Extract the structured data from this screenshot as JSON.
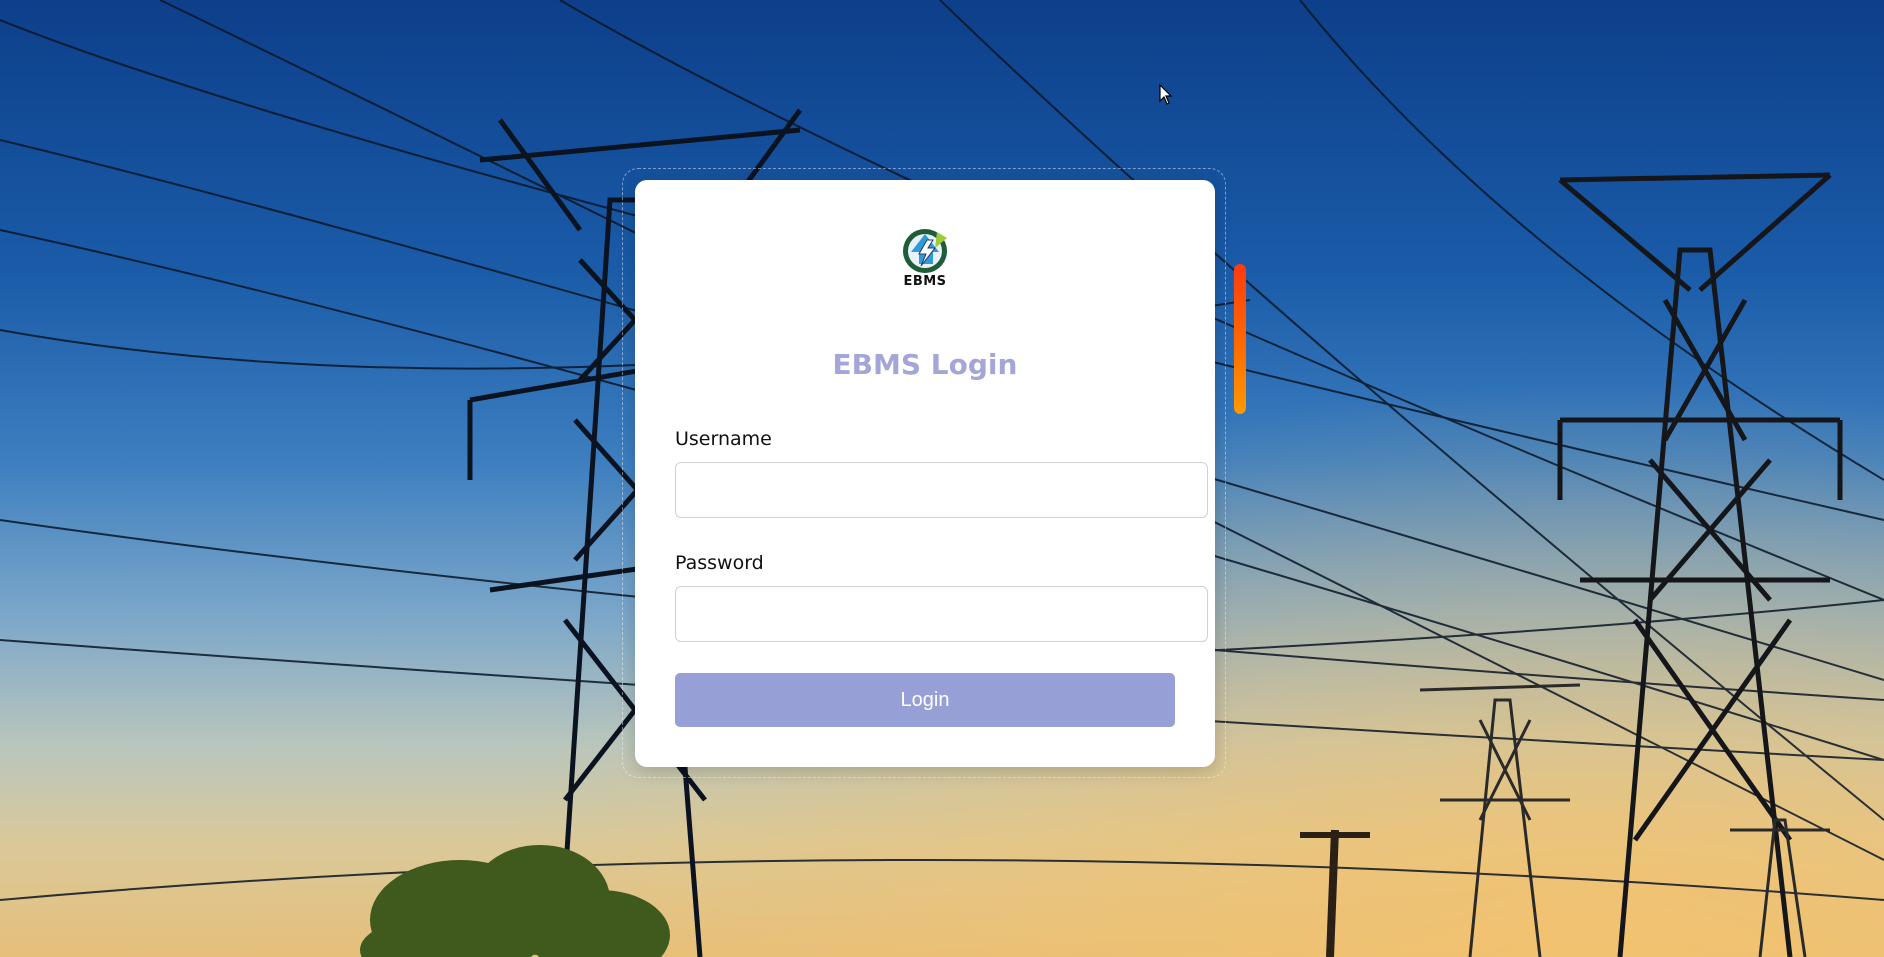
{
  "app": {
    "logo_text": "EBMS",
    "title": "EBMS Login"
  },
  "form": {
    "username_label": "Username",
    "username_value": "",
    "password_label": "Password",
    "password_value": "",
    "login_button_label": "Login"
  },
  "colors": {
    "title": "#a3a6d6",
    "button": "#97a0d6",
    "accent_bar": "#ff5a00"
  },
  "icons": {
    "logo": "ebms-logo-icon",
    "cursor": "mouse-pointer-icon"
  }
}
